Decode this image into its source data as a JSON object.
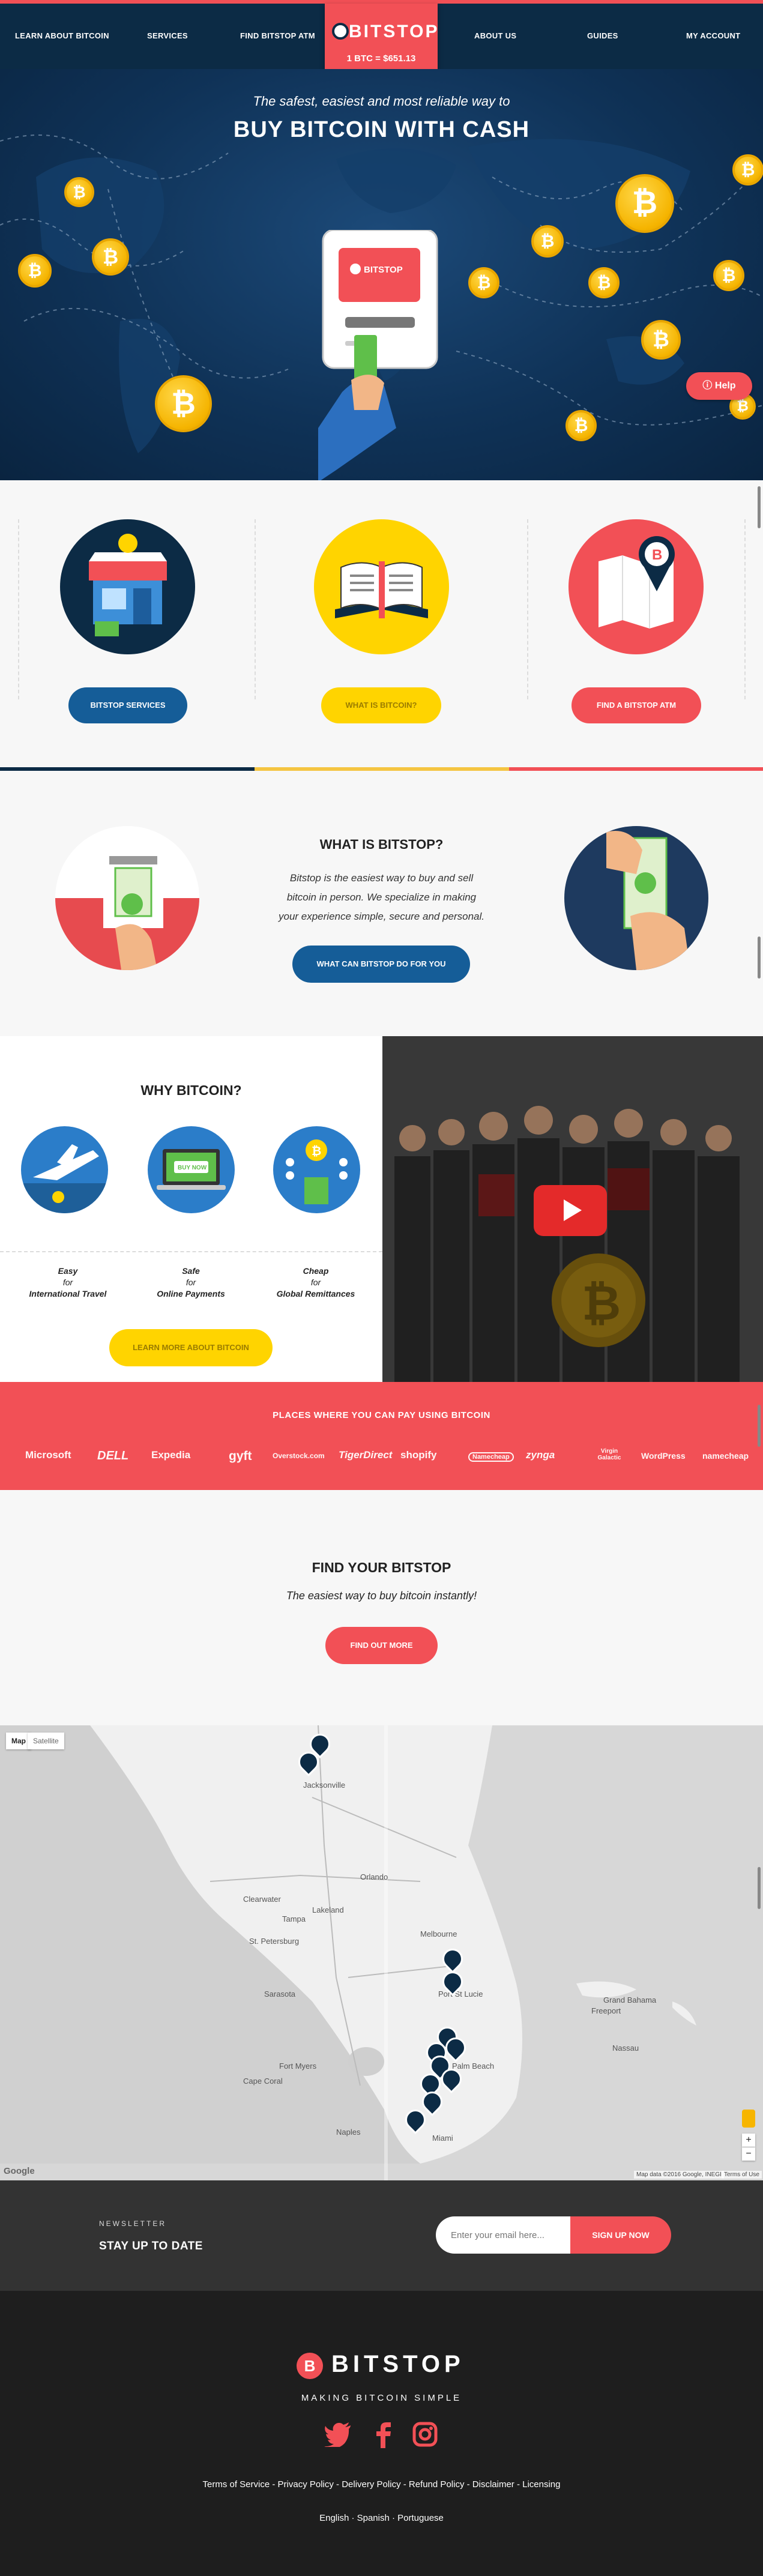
{
  "nav": {
    "items": [
      "LEARN ABOUT BITCOIN",
      "SERVICES",
      "FIND BITSTOP ATM",
      "ABOUT US",
      "GUIDES",
      "MY ACCOUNT"
    ],
    "logo": "BITSTOP",
    "price": "1 BTC = $651.13",
    "active": "GUIDES"
  },
  "hero": {
    "subtitle": "The safest, easiest and most reliable way to",
    "title": "BUY BITCOIN WITH CASH",
    "atm_logo": "BITSTOP",
    "help": "Help"
  },
  "features": {
    "buttons": [
      "BITSTOP SERVICES",
      "WHAT IS BITCOIN?",
      "FIND A BITSTOP ATM"
    ]
  },
  "what": {
    "title": "WHAT IS BITSTOP?",
    "lines": [
      "Bitstop is the easiest way to buy and sell",
      "bitcoin in person. We specialize in making",
      "your experience simple, secure and personal."
    ],
    "button": "WHAT CAN BITSTOP DO FOR YOU"
  },
  "why": {
    "title": "WHY BITCOIN?",
    "items": [
      {
        "a": "Easy",
        "b": "for",
        "c": "International Travel"
      },
      {
        "a": "Safe",
        "b": "for",
        "c": "Online Payments"
      },
      {
        "a": "Cheap",
        "b": "for",
        "c": "Global Remittances"
      }
    ],
    "buy_now": "BUY NOW",
    "button": "LEARN MORE ABOUT BITCOIN"
  },
  "places": {
    "title": "PLACES WHERE YOU CAN PAY USING BITCOIN",
    "brands": [
      "Microsoft",
      "DELL",
      "Expedia",
      "gyft",
      "Overstock.com",
      "TigerDirect",
      "shopify",
      "Namecheap",
      "zynga",
      "Virgin Galactic",
      "WordPress",
      "namecheap"
    ]
  },
  "find": {
    "title": "FIND YOUR BITSTOP",
    "subtitle": "The easiest way to buy bitcoin instantly!",
    "button": "FIND OUT MORE"
  },
  "map": {
    "map_btn": "Map",
    "sat_btn": "Satellite",
    "labels": [
      "Jacksonville",
      "Orlando",
      "Tampa",
      "Clearwater",
      "St. Petersburg",
      "Lakeland",
      "Sarasota",
      "Melbourne",
      "Port St Lucie",
      "West Palm Beach",
      "Fort Myers",
      "Cape Coral",
      "Naples",
      "Miami",
      "Nassau",
      "Grand Bahama",
      "Freeport"
    ],
    "google": "Google",
    "attribution": "Map data ©2016 Google, INEGI",
    "terms": "Terms of Use",
    "zoom_in": "+",
    "zoom_out": "−"
  },
  "newsletter": {
    "small": "NEWSLETTER",
    "title": "STAY UP TO DATE",
    "placeholder": "Enter your email here...",
    "button": "SIGN UP NOW"
  },
  "footer": {
    "logo": "BITSTOP",
    "tagline": "MAKING BITCOIN SIMPLE",
    "links": "Terms of Service  -  Privacy Policy  -  Delivery Policy  -  Refund Policy  -  Disclaimer  -  Licensing",
    "langs": "English  ·  Spanish  ·  Portuguese"
  },
  "colors": {
    "navy": "#0c2b45",
    "red": "#f25056",
    "yellow": "#ffd400",
    "blue": "#155d98",
    "footer": "#1e1e1e"
  }
}
